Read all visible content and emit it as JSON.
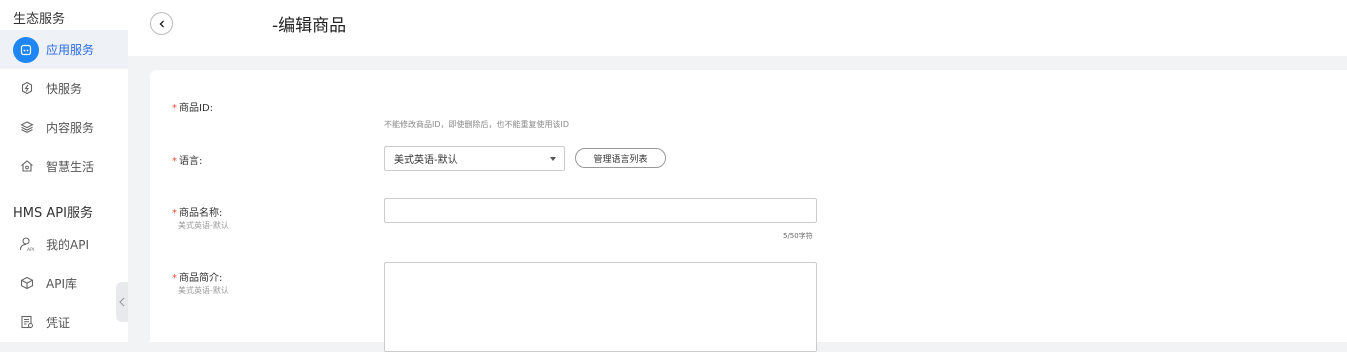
{
  "sidebar": {
    "group1_title": "生态服务",
    "group2_title": "HMS API服务",
    "items": [
      {
        "label": "应用服务",
        "icon": "app-services-icon",
        "active": true
      },
      {
        "label": "快服务",
        "icon": "quick-services-icon"
      },
      {
        "label": "内容服务",
        "icon": "content-services-icon"
      },
      {
        "label": "智慧生活",
        "icon": "smart-home-icon"
      },
      {
        "label": "我的API",
        "icon": "my-api-icon"
      },
      {
        "label": "API库",
        "icon": "api-library-icon"
      },
      {
        "label": "凭证",
        "icon": "credentials-icon"
      }
    ]
  },
  "header": {
    "title": "-编辑商品"
  },
  "form": {
    "product_id": {
      "label": "商品ID:",
      "hint": "不能修改商品ID，即使删除后，也不能重复使用该ID"
    },
    "language": {
      "label": "语言:",
      "selected": "美式英语-默认",
      "manage_button": "管理语言列表"
    },
    "product_name": {
      "label": "商品名称:",
      "sublabel": "美式英语-默认",
      "value": "",
      "counter": "5/50字符"
    },
    "product_desc": {
      "label": "商品简介:",
      "sublabel": "美式英语-默认",
      "value": ""
    },
    "required_mark": "*"
  },
  "colors": {
    "accent": "#1f87f5",
    "required": "#e84c3d",
    "active_bg": "#eef1f6"
  }
}
